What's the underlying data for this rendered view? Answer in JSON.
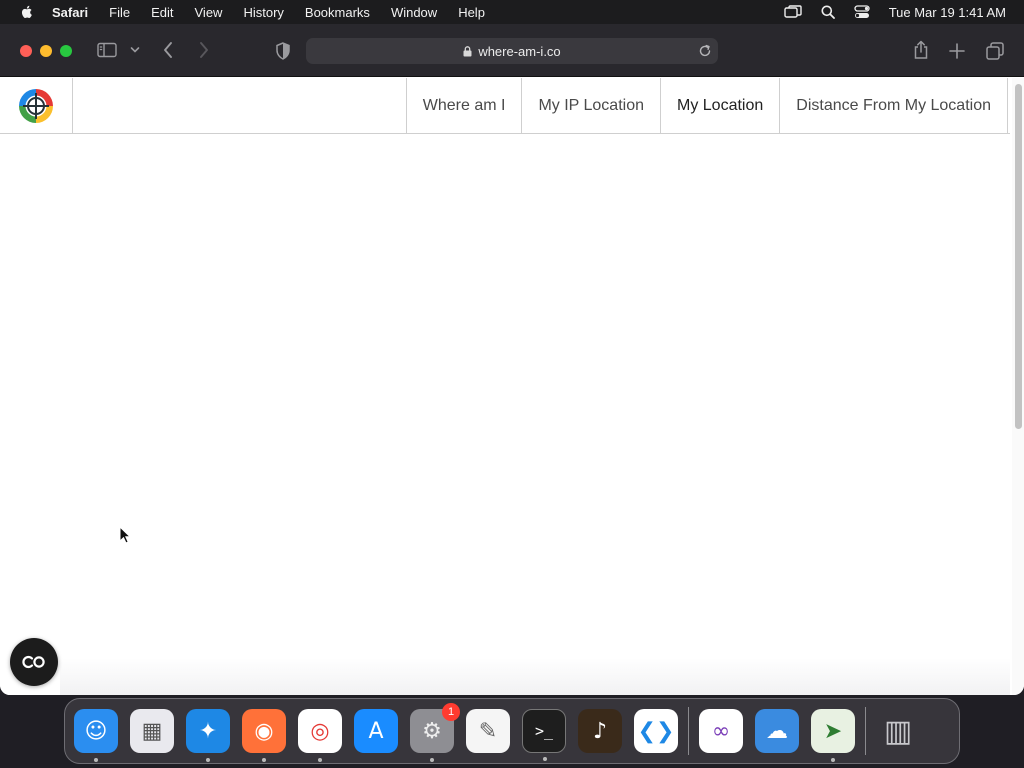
{
  "menubar": {
    "app_name": "Safari",
    "items": [
      "File",
      "Edit",
      "View",
      "History",
      "Bookmarks",
      "Window",
      "Help"
    ],
    "clock": "Tue Mar 19  1:41 AM"
  },
  "browser": {
    "url": "where-am-i.co"
  },
  "site": {
    "nav": [
      {
        "label": "Where am I",
        "active": false
      },
      {
        "label": "My IP Location",
        "active": false
      },
      {
        "label": "My Location",
        "active": true
      },
      {
        "label": "Distance From My Location",
        "active": false
      }
    ]
  },
  "dock": {
    "apps": [
      {
        "name": "Finder",
        "icon": "finder-icon",
        "color": "#2b8ef0",
        "running": true
      },
      {
        "name": "Launchpad",
        "icon": "launchpad-icon",
        "color": "#e9e9ee",
        "running": false
      },
      {
        "name": "Safari",
        "icon": "safari-icon",
        "color": "#1e88e5",
        "running": true
      },
      {
        "name": "Firefox",
        "icon": "firefox-icon",
        "color": "#ff7139",
        "running": true
      },
      {
        "name": "Chrome",
        "icon": "chrome-icon",
        "color": "#ffffff",
        "running": true
      },
      {
        "name": "App Store",
        "icon": "app-store-icon",
        "color": "#1a8cff",
        "running": false
      },
      {
        "name": "System Settings",
        "icon": "system-settings-icon",
        "color": "#8e8e93",
        "running": true,
        "badge": "1"
      },
      {
        "name": "TextEdit",
        "icon": "textedit-icon",
        "color": "#f5f5f5",
        "running": false
      },
      {
        "name": "Terminal",
        "icon": "terminal-icon",
        "color": "#1e1e1e",
        "running": true
      },
      {
        "name": "GarageBand",
        "icon": "garageband-icon",
        "color": "#3a2a1a",
        "running": false
      },
      {
        "name": "Visual Studio Code",
        "icon": "vscode-icon",
        "color": "#ffffff",
        "running": false
      }
    ],
    "recent": [
      {
        "name": "Visual Studio",
        "icon": "visual-studio-icon",
        "color": "#ffffff",
        "running": false
      },
      {
        "name": "Weather",
        "icon": "weather-icon",
        "color": "#3a8be0",
        "running": false
      },
      {
        "name": "Maps",
        "icon": "maps-icon",
        "color": "#e8f1e2",
        "running": true
      }
    ],
    "trash": {
      "name": "Trash",
      "icon": "trash-icon"
    }
  }
}
